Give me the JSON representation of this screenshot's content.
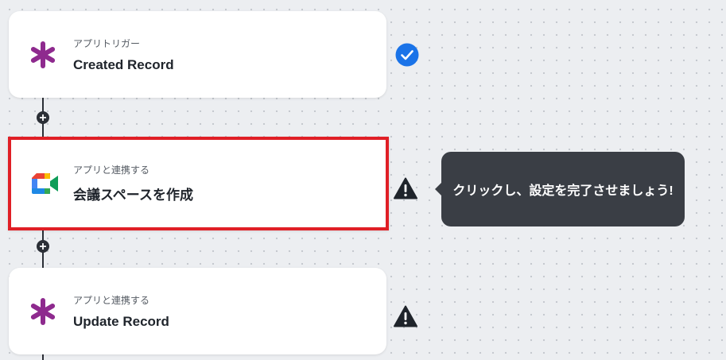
{
  "colors": {
    "canvas": "#eceef1",
    "connector": "#2b2f36",
    "highlight_border": "#e01f26",
    "success": "#1a73e8",
    "warning": "#1f242b",
    "asterisk": "#8e2a8e",
    "tooltip_bg": "#3a3e45"
  },
  "steps": [
    {
      "caption": "アプリトリガー",
      "title": "Created Record",
      "icon": "asterisk-app-icon",
      "status": "check-circle-icon"
    },
    {
      "caption": "アプリと連携する",
      "title": "会議スペースを作成",
      "icon": "google-meet-icon",
      "status": "warning-icon",
      "highlighted": true
    },
    {
      "caption": "アプリと連携する",
      "title": "Update Record",
      "icon": "asterisk-app-icon",
      "status": "warning-icon"
    }
  ],
  "tooltip": {
    "text": "クリックし、設定を完了させましょう!"
  }
}
